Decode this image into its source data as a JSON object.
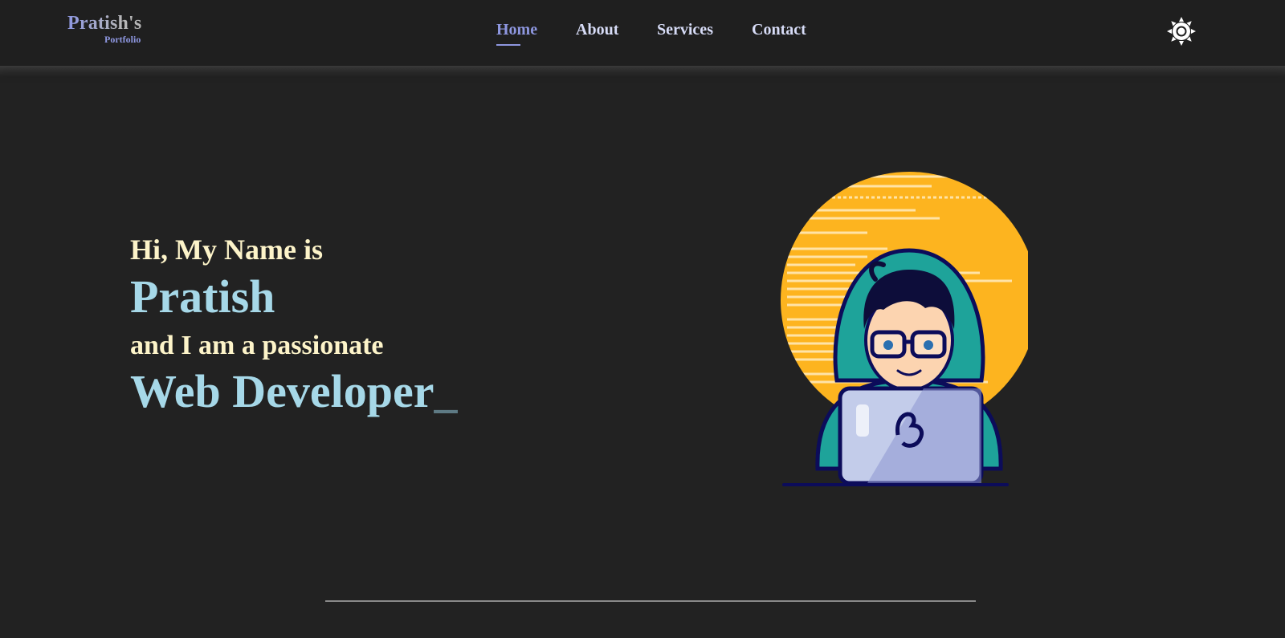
{
  "brand": {
    "name": "Pratish's",
    "tagline": "Portfolio"
  },
  "nav": {
    "items": [
      {
        "label": "Home",
        "active": true
      },
      {
        "label": "About",
        "active": false
      },
      {
        "label": "Services",
        "active": false
      },
      {
        "label": "Contact",
        "active": false
      }
    ],
    "theme_toggle_icon": "sun-icon"
  },
  "hero": {
    "greeting": "Hi, My Name is",
    "name": "Pratish",
    "intro": "and I am a passionate",
    "role": "Web Developer",
    "cursor": "_",
    "illustration_icon": "developer-with-laptop-illustration"
  },
  "colors": {
    "background": "#222222",
    "navbar": "#1f1f1f",
    "accent": "#8e97e0",
    "highlight": "#a6d8e8",
    "cream": "#fdf4c9",
    "circle": "#fdb41f"
  }
}
